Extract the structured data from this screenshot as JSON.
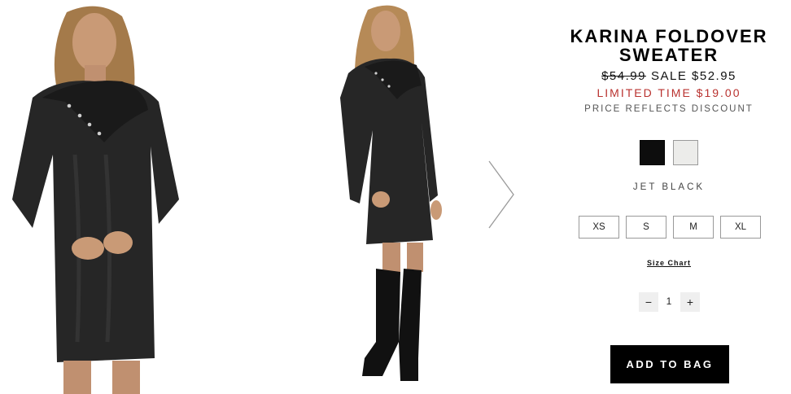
{
  "product": {
    "title_line1": "KARINA FOLDOVER",
    "title_line2": "SWEATER",
    "original_price": "$54.99",
    "sale_price": "SALE $52.95",
    "limited_time": "LIMITED TIME $19.00",
    "price_note": "PRICE REFLECTS DISCOUNT"
  },
  "colors": {
    "selected_name": "JET BLACK",
    "swatches": [
      "#0d0d0d",
      "#ececea"
    ]
  },
  "sizes": [
    "XS",
    "S",
    "M",
    "XL"
  ],
  "size_chart_label": "Size Chart",
  "quantity": {
    "minus": "−",
    "value": "1",
    "plus": "+"
  },
  "add_to_bag_label": "ADD TO BAG",
  "theme": {
    "sale_red": "#b9322f",
    "button_black": "#000000"
  }
}
